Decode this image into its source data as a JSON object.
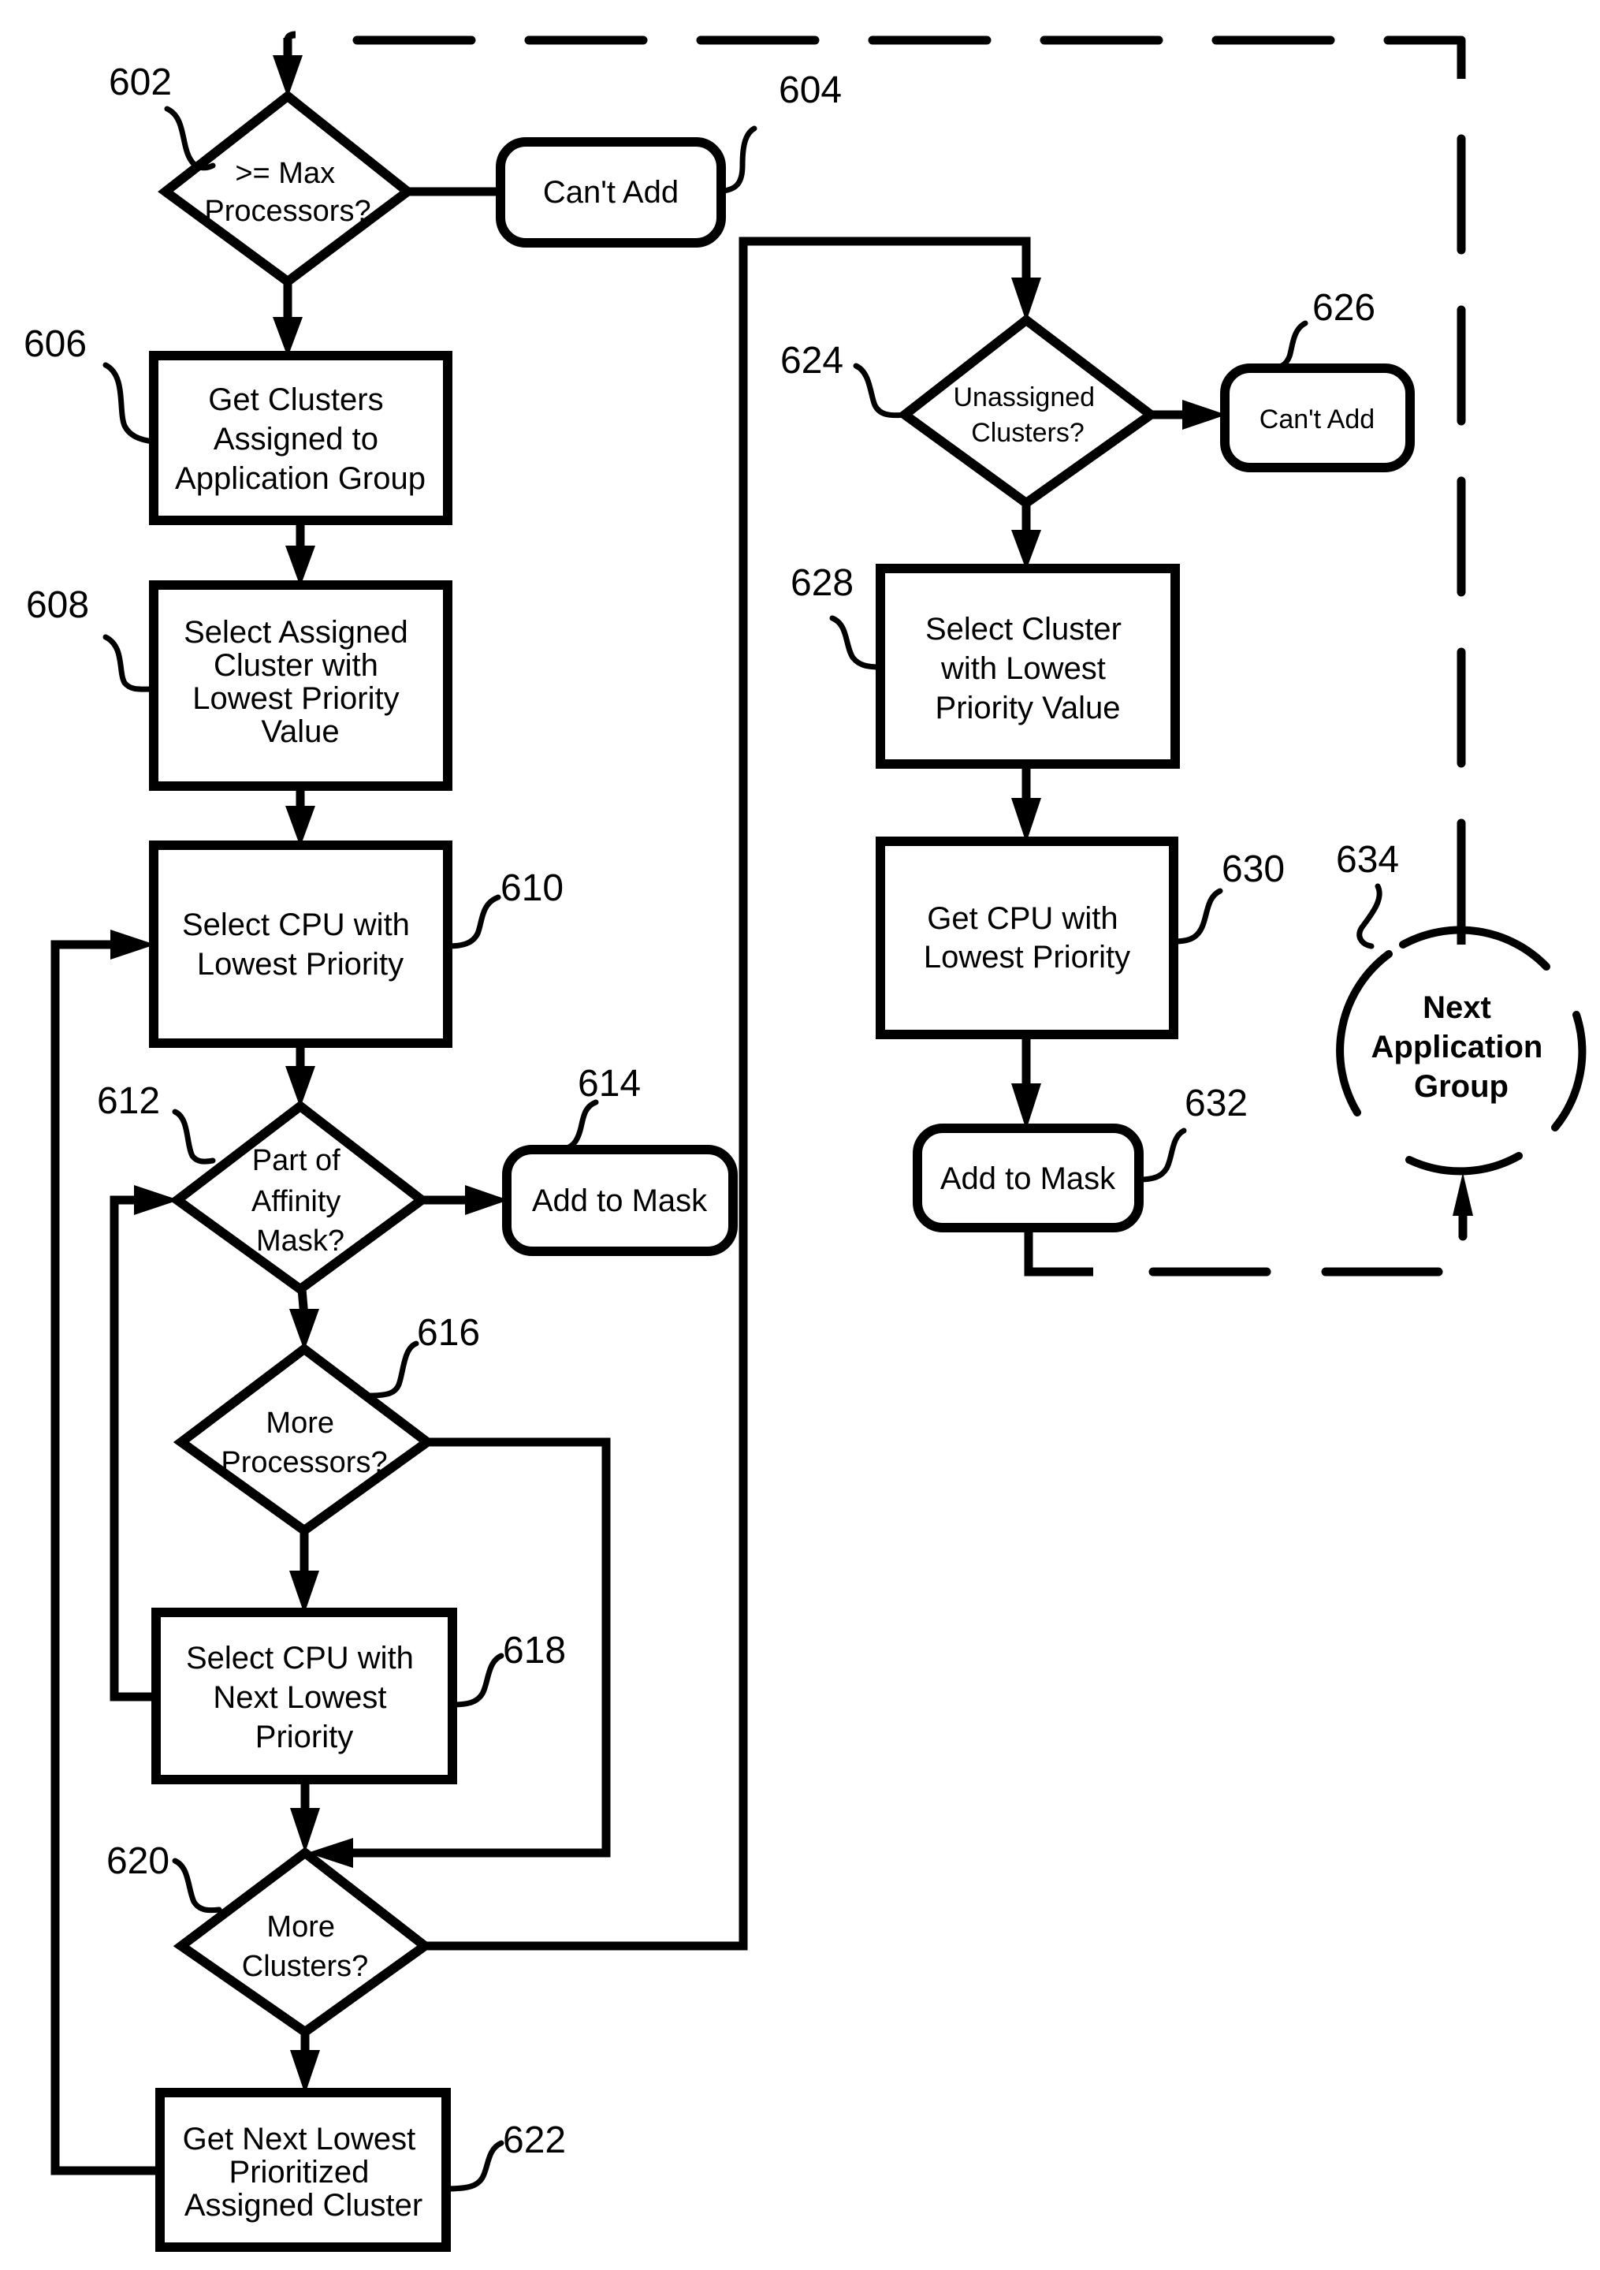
{
  "figure": {
    "type": "flowchart",
    "colors": {
      "ink": "#000000",
      "background": "#ffffff"
    }
  },
  "nodes": {
    "n602": {
      "ref": "602",
      "shape": "decision",
      "lines": [
        ">= Max",
        "Processors?"
      ]
    },
    "n604": {
      "ref": "604",
      "shape": "terminal",
      "lines": [
        "Can't Add"
      ]
    },
    "n606": {
      "ref": "606",
      "shape": "process",
      "lines": [
        "Get Clusters",
        "Assigned to",
        "Application Group"
      ]
    },
    "n608": {
      "ref": "608",
      "shape": "process",
      "lines": [
        "Select Assigned",
        "Cluster with",
        "Lowest Priority",
        "Value"
      ]
    },
    "n610": {
      "ref": "610",
      "shape": "process",
      "lines": [
        "Select CPU with",
        "Lowest Priority"
      ]
    },
    "n612": {
      "ref": "612",
      "shape": "decision",
      "lines": [
        "Part of",
        "Affinity",
        "Mask?"
      ]
    },
    "n614": {
      "ref": "614",
      "shape": "terminal",
      "lines": [
        "Add to Mask"
      ]
    },
    "n616": {
      "ref": "616",
      "shape": "decision",
      "lines": [
        "More",
        "Processors?"
      ]
    },
    "n618": {
      "ref": "618",
      "shape": "process",
      "lines": [
        "Select CPU with",
        "Next Lowest",
        "Priority"
      ]
    },
    "n620": {
      "ref": "620",
      "shape": "decision",
      "lines": [
        "More",
        "Clusters?"
      ]
    },
    "n622": {
      "ref": "622",
      "shape": "process",
      "lines": [
        "Get Next Lowest",
        "Prioritized",
        "Assigned Cluster"
      ]
    },
    "n624": {
      "ref": "624",
      "shape": "decision",
      "lines": [
        "Unassigned",
        "Clusters?"
      ]
    },
    "n626": {
      "ref": "626",
      "shape": "terminal",
      "lines": [
        "Can't Add"
      ]
    },
    "n628": {
      "ref": "628",
      "shape": "process",
      "lines": [
        "Select Cluster",
        "with Lowest",
        "Priority Value"
      ]
    },
    "n630": {
      "ref": "630",
      "shape": "process",
      "lines": [
        "Get CPU with",
        "Lowest Priority"
      ]
    },
    "n632": {
      "ref": "632",
      "shape": "terminal",
      "lines": [
        "Add to Mask"
      ]
    },
    "n634": {
      "ref": "634",
      "shape": "connector",
      "lines": [
        "Next",
        "Application",
        "Group"
      ]
    }
  },
  "edges": [
    {
      "from": "start",
      "to": "602"
    },
    {
      "from": "602",
      "to": "604"
    },
    {
      "from": "602",
      "to": "606"
    },
    {
      "from": "606",
      "to": "608"
    },
    {
      "from": "608",
      "to": "610"
    },
    {
      "from": "610",
      "to": "612"
    },
    {
      "from": "612",
      "to": "614"
    },
    {
      "from": "612",
      "to": "616"
    },
    {
      "from": "616",
      "to": "618"
    },
    {
      "from": "616",
      "to": "620"
    },
    {
      "from": "618",
      "to": "612"
    },
    {
      "from": "618",
      "to": "620"
    },
    {
      "from": "620",
      "to": "622"
    },
    {
      "from": "620",
      "to": "624"
    },
    {
      "from": "622",
      "to": "610"
    },
    {
      "from": "624",
      "to": "626"
    },
    {
      "from": "624",
      "to": "628"
    },
    {
      "from": "628",
      "to": "630"
    },
    {
      "from": "630",
      "to": "632"
    },
    {
      "from": "632",
      "to": "634",
      "style": "dashed"
    },
    {
      "from": "634",
      "to": "602",
      "style": "dashed"
    }
  ]
}
